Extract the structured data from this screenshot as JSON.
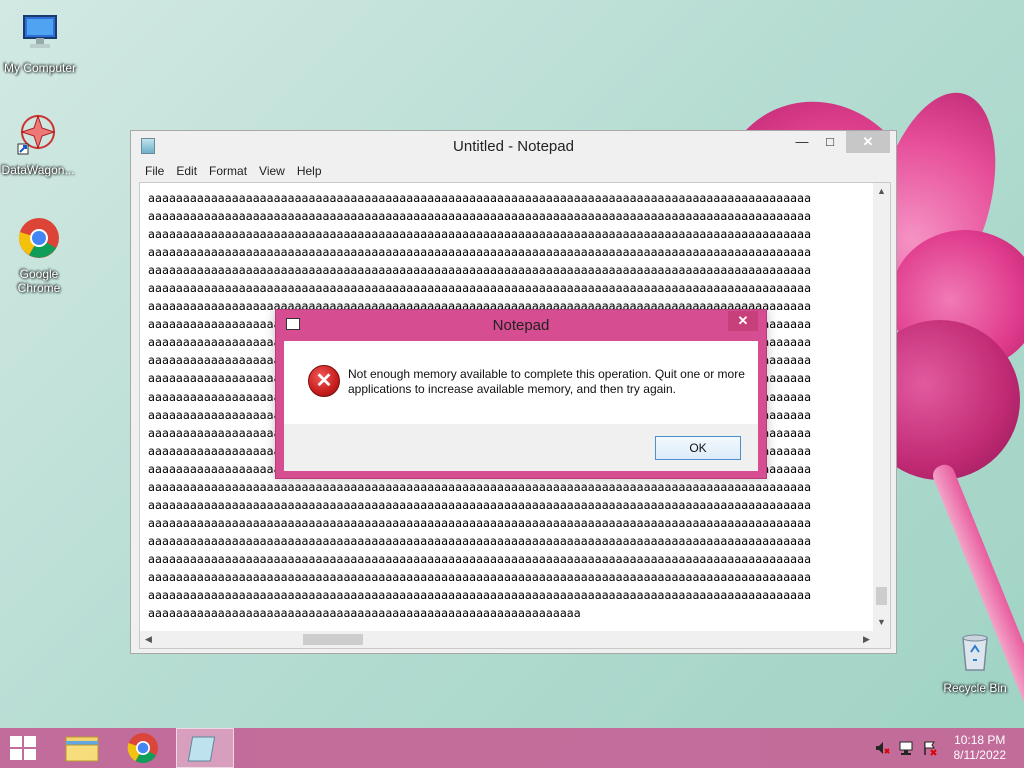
{
  "desktop": {
    "icons": [
      {
        "label": "My Computer"
      },
      {
        "label": "DataWagon..."
      },
      {
        "label": "Google\nChrome"
      },
      {
        "label": "Recycle Bin"
      }
    ]
  },
  "notepad": {
    "title": "Untitled - Notepad",
    "menu": [
      "File",
      "Edit",
      "Format",
      "View",
      "Help"
    ],
    "full_line": "aaaaaaaaaaaaaaaaaaaaaaaaaaaaaaaaaaaaaaaaaaaaaaaaaaaaaaaaaaaaaaaaaaaaaaaaaaaaaaaaaaaaaaaaaaaaaaa",
    "last_line": "aaaaaaaaaaaaaaaaaaaaaaaaaaaaaaaaaaaaaaaaaaaaaaaaaaaaaaaaaaaaaa",
    "line_count": 24
  },
  "dialog": {
    "title": "Notepad",
    "message": "Not enough memory available to complete this operation. Quit one or more applications to increase available memory, and then try again.",
    "ok_label": "OK"
  },
  "taskbar": {
    "clock_time": "10:18 PM",
    "clock_date": "8/11/2022"
  },
  "colors": {
    "accent": "#d64d91",
    "taskbar": "#c36a9a"
  }
}
